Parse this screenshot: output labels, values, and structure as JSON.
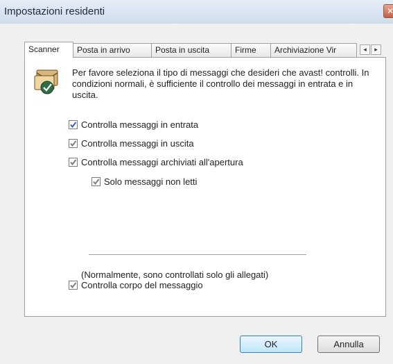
{
  "window": {
    "title": "Impostazioni residenti",
    "close_glyph": "✕"
  },
  "tabs": [
    {
      "label": "Scanner"
    },
    {
      "label": "Posta in arrivo"
    },
    {
      "label": "Posta in uscita"
    },
    {
      "label": "Firme"
    },
    {
      "label": "Archiviazione Vir"
    }
  ],
  "tab_scroll": {
    "left_glyph": "◂",
    "right_glyph": "▸"
  },
  "panel": {
    "icon": "mail-scan-icon",
    "intro": "Per favore seleziona il tipo di messaggi che desideri che avast! controlli. In condizioni normali, è sufficiente il controllo dei messaggi in entrata e in uscita.",
    "options": [
      {
        "label": "Controlla messaggi in entrata",
        "checked": true
      },
      {
        "label": "Controlla messaggi in uscita",
        "checked": true
      },
      {
        "label": "Controlla messaggi archiviati all'apertura",
        "checked": true
      },
      {
        "label": "Solo messaggi non letti",
        "checked": true
      },
      {
        "label": "Controlla corpo del messaggio",
        "checked": true
      }
    ],
    "body_note": "(Normalmente, sono controllati solo gli allegati)"
  },
  "buttons": {
    "ok": "OK",
    "cancel": "Annulla"
  },
  "colors": {
    "checkmark": "#3a5fbf",
    "checkmark_disabled": "#7d7d7d"
  }
}
